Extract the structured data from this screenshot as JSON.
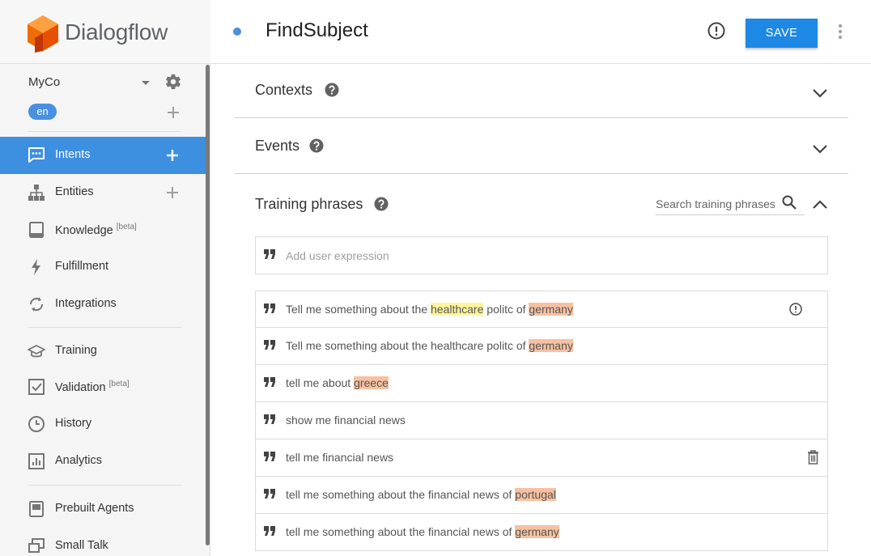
{
  "app": {
    "brand": "Dialogflow",
    "accent": "#3d8fe0"
  },
  "agent": {
    "name": "MyCo",
    "language": "en"
  },
  "nav": [
    {
      "label": "Intents",
      "icon": "intents-chat-icon",
      "plus": true,
      "active": true
    },
    {
      "label": "Entities",
      "icon": "entities-hierarchy-icon",
      "plus": true
    },
    {
      "label": "Knowledge",
      "badge": "[beta]",
      "icon": "knowledge-book-icon"
    },
    {
      "label": "Fulfillment",
      "icon": "fulfillment-bolt-icon"
    },
    {
      "label": "Integrations",
      "icon": "integrations-sync-icon"
    },
    {
      "label": "Training",
      "icon": "training-cap-icon"
    },
    {
      "label": "Validation",
      "badge": "[beta]",
      "icon": "validation-check-icon"
    },
    {
      "label": "History",
      "icon": "history-clock-icon"
    },
    {
      "label": "Analytics",
      "icon": "analytics-chart-icon"
    },
    {
      "label": "Prebuilt Agents",
      "icon": "prebuilt-agents-icon"
    },
    {
      "label": "Small Talk",
      "icon": "small-talk-icon"
    }
  ],
  "header": {
    "intent_name": "FindSubject",
    "save_label": "SAVE"
  },
  "sections": {
    "contexts": "Contexts",
    "events": "Events",
    "training": "Training phrases"
  },
  "training": {
    "search_placeholder": "Search training phrases",
    "add_placeholder": "Add user expression",
    "phrases": [
      {
        "segments": [
          {
            "t": "Tell me something about the "
          },
          {
            "t": "healthcare",
            "hl": "yellow"
          },
          {
            "t": " politc of "
          },
          {
            "t": "germany",
            "hl": "orange"
          }
        ],
        "warning": true
      },
      {
        "segments": [
          {
            "t": "Tell me something about the healthcare politc of "
          },
          {
            "t": "germany",
            "hl": "orange"
          }
        ]
      },
      {
        "segments": [
          {
            "t": "tell me about "
          },
          {
            "t": "greece",
            "hl": "orange"
          }
        ]
      },
      {
        "segments": [
          {
            "t": "show me financial news"
          }
        ]
      },
      {
        "segments": [
          {
            "t": "tell me financial news"
          }
        ],
        "trash": true
      },
      {
        "segments": [
          {
            "t": "tell me something about the financial news of "
          },
          {
            "t": "portugal",
            "hl": "orange"
          }
        ]
      },
      {
        "segments": [
          {
            "t": "tell me something about the financial news of "
          },
          {
            "t": "germany",
            "hl": "orange"
          }
        ]
      }
    ]
  }
}
